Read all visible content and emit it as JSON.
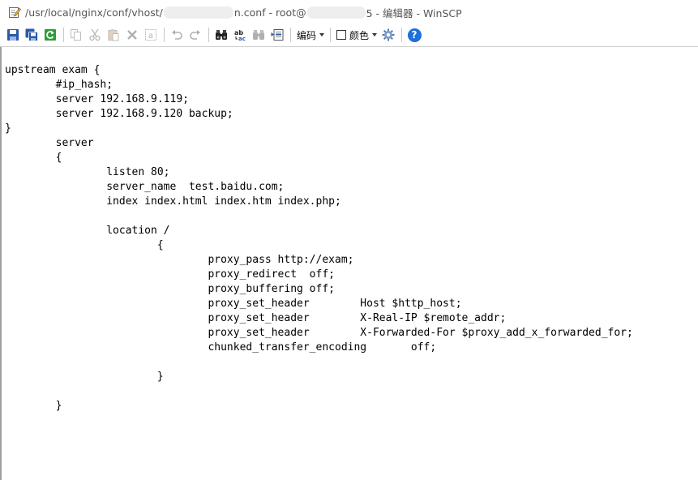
{
  "window": {
    "title_path_start": "/usr/local/nginx/conf/vhost/",
    "title_path_end": "n.conf - root@",
    "title_suffix": "5 - 编辑器 - WinSCP"
  },
  "toolbar": {
    "buttons": [
      {
        "name": "save-icon",
        "enabled": true
      },
      {
        "name": "save-all-icon",
        "enabled": true
      },
      {
        "name": "reload-icon",
        "enabled": true
      },
      {
        "name": "copy-icon",
        "enabled": false
      },
      {
        "name": "cut-icon",
        "enabled": false
      },
      {
        "name": "paste-icon",
        "enabled": false
      },
      {
        "name": "delete-icon",
        "enabled": false
      },
      {
        "name": "select-all-icon",
        "enabled": false
      },
      {
        "name": "undo-icon",
        "enabled": false
      },
      {
        "name": "redo-icon",
        "enabled": false
      },
      {
        "name": "find-icon",
        "enabled": true
      },
      {
        "name": "replace-icon",
        "enabled": true
      },
      {
        "name": "find-next-icon",
        "enabled": false
      },
      {
        "name": "goto-line-icon",
        "enabled": true
      },
      {
        "name": "gear-icon",
        "enabled": true
      },
      {
        "name": "help-icon",
        "enabled": true
      }
    ],
    "encoding_label": "编码",
    "color_label": "颜色",
    "help_glyph": "?"
  },
  "editor": {
    "lines": [
      "upstream exam {",
      "        #ip_hash;",
      "        server 192.168.9.119;",
      "        server 192.168.9.120 backup;",
      "}",
      "        server",
      "        {",
      "                listen 80;",
      "                server_name  test.baidu.com;",
      "                index index.html index.htm index.php;",
      "",
      "                location /",
      "                        {",
      "                                proxy_pass http://exam;",
      "                                proxy_redirect  off;",
      "                                proxy_buffering off;",
      "                                proxy_set_header        Host $http_host;",
      "                                proxy_set_header        X-Real-IP $remote_addr;",
      "                                proxy_set_header        X-Forwarded-For $proxy_add_x_forwarded_for;",
      "                                chunked_transfer_encoding       off;",
      "",
      "                        }",
      "",
      "        }"
    ]
  },
  "colors": {
    "help_blue": "#1e6fd9",
    "save_blue": "#2b5aa8",
    "reload_green": "#2e9b3a",
    "text": "#000000"
  }
}
